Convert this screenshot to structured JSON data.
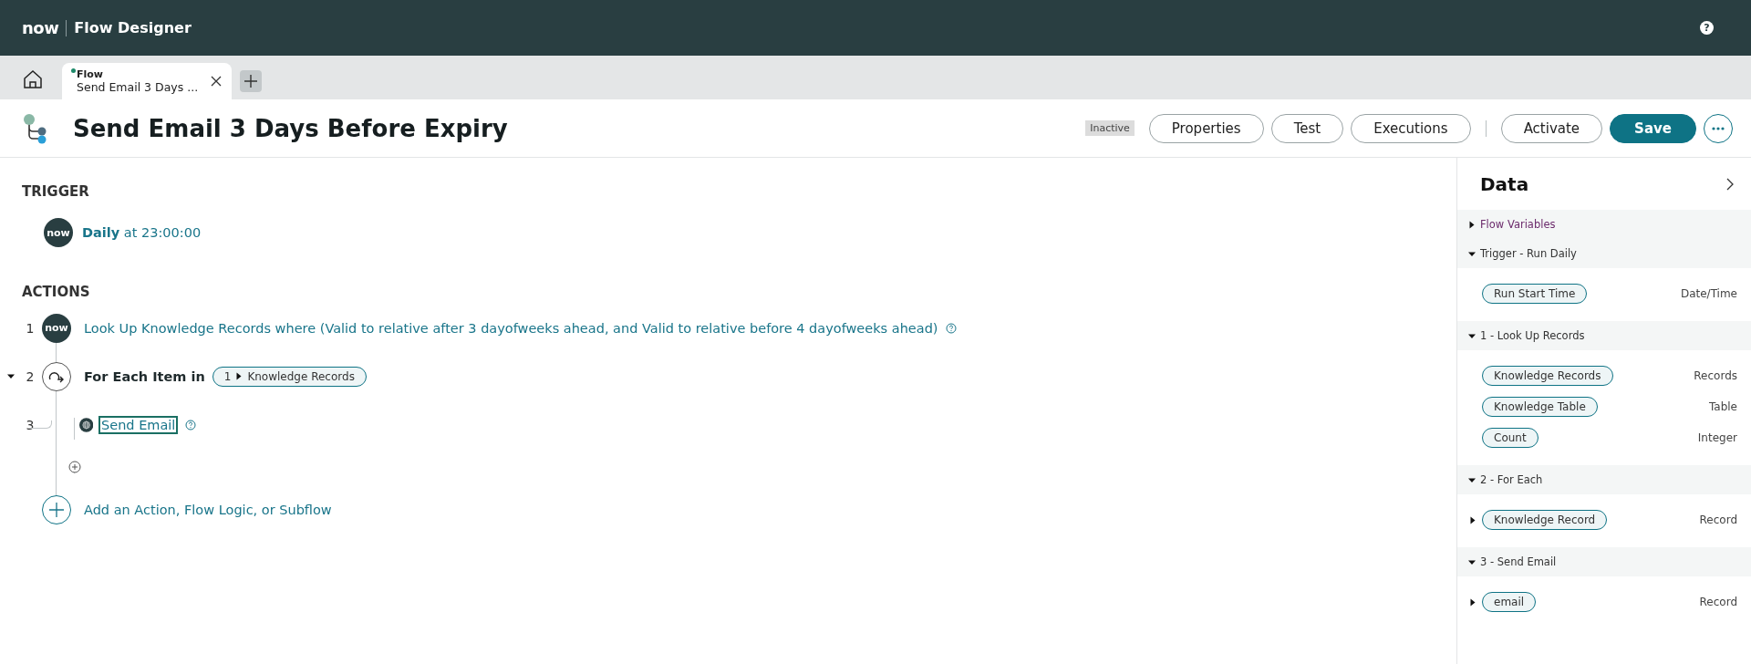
{
  "header": {
    "logo": "now",
    "app_title": "Flow Designer",
    "help": "?"
  },
  "tabs": [
    {
      "type_label": "Flow",
      "title": "Send Email 3 Days ...",
      "selected": true,
      "modified": true
    }
  ],
  "flow": {
    "title": "Send Email 3 Days Before Expiry",
    "status": "Inactive",
    "button_groups": [
      [
        {
          "label": "Properties",
          "kind": "outline"
        },
        {
          "label": "Test",
          "kind": "outline"
        },
        {
          "label": "Executions",
          "kind": "outline"
        }
      ],
      [
        {
          "label": "Activate",
          "kind": "outline"
        },
        {
          "label": "Save",
          "kind": "primary"
        }
      ]
    ]
  },
  "trigger": {
    "heading": "TRIGGER",
    "badge": "now",
    "label": "Daily",
    "detail": "at 23:00:00"
  },
  "actions": {
    "heading": "ACTIONS",
    "steps": [
      {
        "number": "1",
        "kind": "action",
        "badge": "now",
        "text": "Look Up Knowledge Records where (Valid to relative after 3 dayofweeks ahead, and Valid to relative before 4 dayofweeks ahead)",
        "help": true,
        "focused": false
      },
      {
        "number": "2",
        "kind": "logic",
        "label": "For Each Item in",
        "pill_number": "1",
        "pill_label": "Knowledge Records",
        "expanded": true,
        "children": [
          {
            "number": "3",
            "kind": "web_action",
            "text": "Send Email",
            "help": true,
            "focused": true
          }
        ]
      }
    ],
    "add_label": "Add an Action, Flow Logic, or Subflow"
  },
  "data_panel": {
    "title": "Data",
    "groups": [
      {
        "label": "Flow Variables",
        "expanded": false
      },
      {
        "label": "Trigger - Run Daily",
        "expanded": true,
        "items": [
          {
            "label": "Run Start Time",
            "type": "Date/Time",
            "expandable": false
          }
        ]
      },
      {
        "label": "1 - Look Up Records",
        "expanded": true,
        "items": [
          {
            "label": "Knowledge Records",
            "type": "Records",
            "expandable": false
          },
          {
            "label": "Knowledge Table",
            "type": "Table",
            "expandable": false
          },
          {
            "label": "Count",
            "type": "Integer",
            "expandable": false
          }
        ]
      },
      {
        "label": "2 - For Each",
        "expanded": true,
        "items": [
          {
            "label": "Knowledge Record",
            "type": "Record",
            "expandable": true
          }
        ]
      },
      {
        "label": "3 - Send Email",
        "expanded": true,
        "items": [
          {
            "label": "email",
            "type": "Record",
            "expandable": true
          }
        ]
      }
    ]
  }
}
